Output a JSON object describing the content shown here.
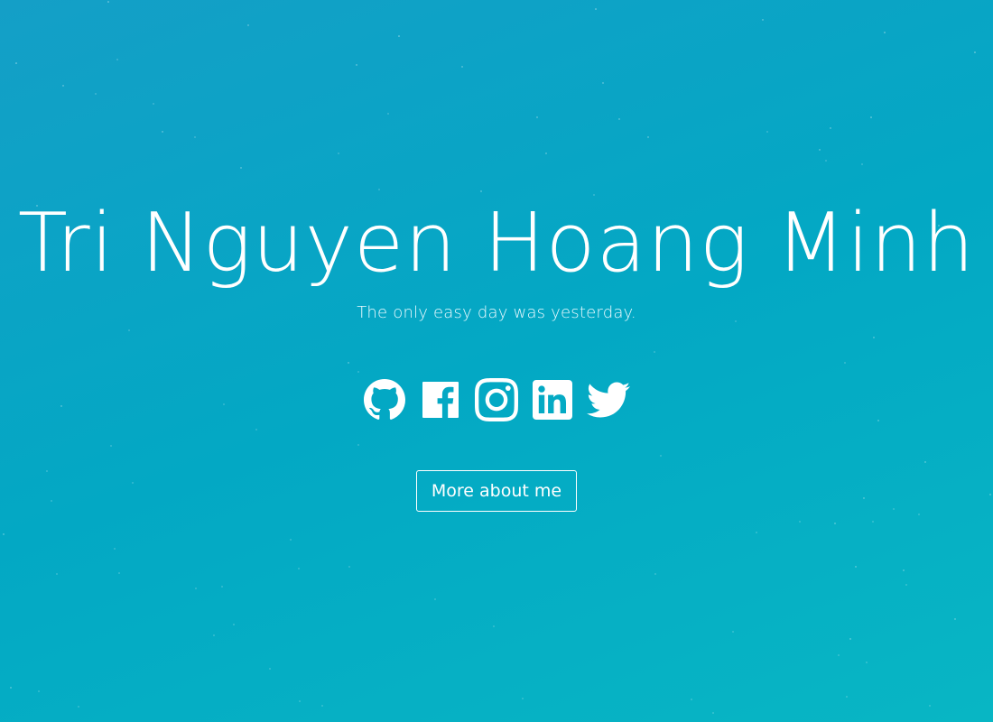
{
  "hero": {
    "title": "Tri Nguyen Hoang Minh",
    "tagline": "The only easy day was yesterday."
  },
  "social": [
    {
      "name": "github",
      "icon": "github-icon"
    },
    {
      "name": "facebook",
      "icon": "facebook-icon"
    },
    {
      "name": "instagram",
      "icon": "instagram-icon"
    },
    {
      "name": "linkedin",
      "icon": "linkedin-icon"
    },
    {
      "name": "twitter",
      "icon": "twitter-icon"
    }
  ],
  "cta": {
    "label": "More about me"
  },
  "colors": {
    "background_start": "#149fc7",
    "background_end": "#08b6c4",
    "foreground": "#ffffff"
  }
}
